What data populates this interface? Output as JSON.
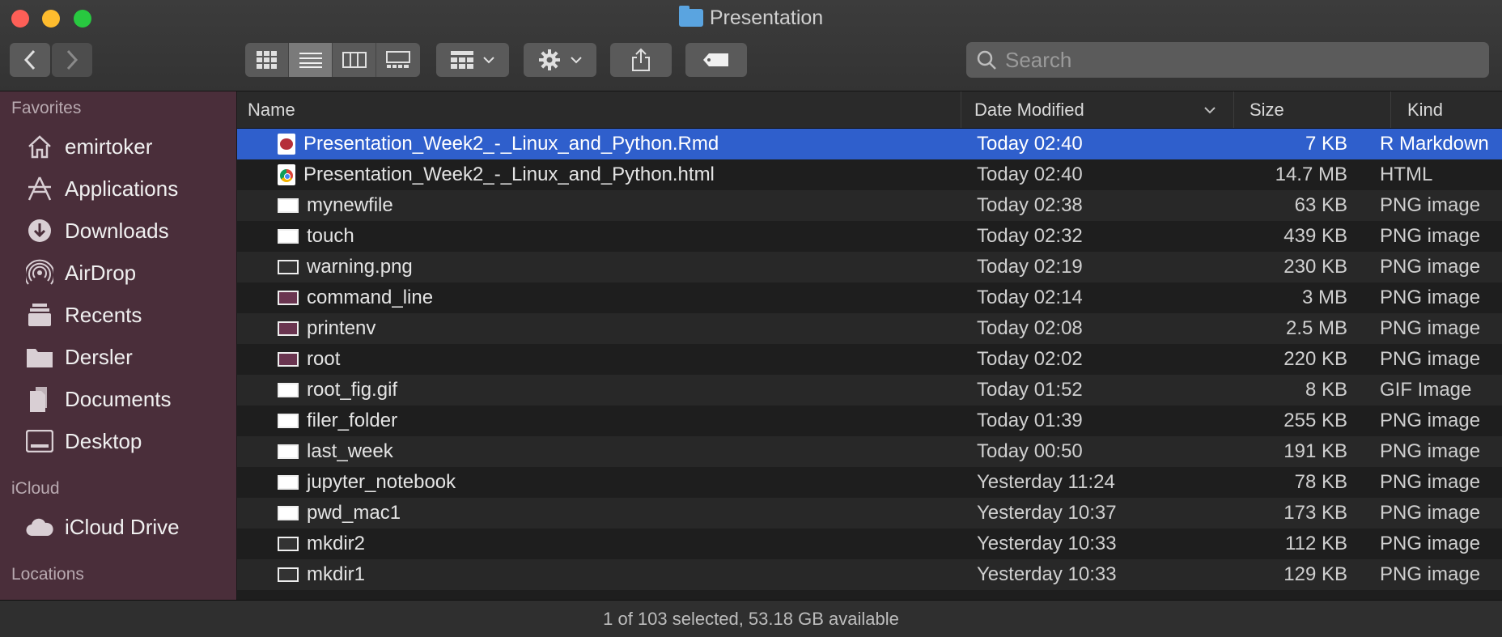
{
  "window": {
    "title": "Presentation"
  },
  "toolbar": {
    "back_icon": "chevron-left-icon",
    "forward_icon": "chevron-right-icon",
    "view_modes": [
      "icon-view-icon",
      "list-view-icon",
      "column-view-icon",
      "gallery-view-icon"
    ],
    "active_view": "list-view-icon",
    "group_icon": "group-by-icon",
    "action_icon": "gear-icon",
    "share_icon": "share-icon",
    "tag_icon": "tag-icon"
  },
  "search": {
    "placeholder": "Search"
  },
  "sidebar": {
    "favorites_header": "Favorites",
    "favorites": [
      {
        "label": "emirtoker",
        "icon": "home-icon"
      },
      {
        "label": "Applications",
        "icon": "applications-icon"
      },
      {
        "label": "Downloads",
        "icon": "downloads-icon"
      },
      {
        "label": "AirDrop",
        "icon": "airdrop-icon"
      },
      {
        "label": "Recents",
        "icon": "recents-icon"
      },
      {
        "label": "Dersler",
        "icon": "folder-icon"
      },
      {
        "label": "Documents",
        "icon": "documents-icon"
      },
      {
        "label": "Desktop",
        "icon": "desktop-icon"
      }
    ],
    "icloud_header": "iCloud",
    "icloud": [
      {
        "label": "iCloud Drive",
        "icon": "cloud-icon"
      }
    ],
    "locations_header": "Locations"
  },
  "columns": {
    "name": "Name",
    "date": "Date Modified",
    "size": "Size",
    "kind": "Kind"
  },
  "files": [
    {
      "name": "Presentation_Week2_-_Linux_and_Python.Rmd",
      "date": "Today 02:40",
      "size": "7 KB",
      "kind": "R Markdown",
      "selected": true,
      "icon": "rmd-file-icon"
    },
    {
      "name": "Presentation_Week2_-_Linux_and_Python.html",
      "date": "Today 02:40",
      "size": "14.7 MB",
      "kind": "HTML",
      "icon": "chrome-html-icon"
    },
    {
      "name": "mynewfile",
      "date": "Today 02:38",
      "size": "63 KB",
      "kind": "PNG image",
      "icon": "png-thumbnail-icon"
    },
    {
      "name": "touch",
      "date": "Today 02:32",
      "size": "439 KB",
      "kind": "PNG image",
      "icon": "png-thumbnail-icon"
    },
    {
      "name": "warning.png",
      "date": "Today 02:19",
      "size": "230 KB",
      "kind": "PNG image",
      "icon": "png-thumbnail-icon"
    },
    {
      "name": "command_line",
      "date": "Today 02:14",
      "size": "3 MB",
      "kind": "PNG image",
      "icon": "png-thumbnail-icon"
    },
    {
      "name": "printenv",
      "date": "Today 02:08",
      "size": "2.5 MB",
      "kind": "PNG image",
      "icon": "png-thumbnail-icon"
    },
    {
      "name": "root",
      "date": "Today 02:02",
      "size": "220 KB",
      "kind": "PNG image",
      "icon": "png-thumbnail-icon"
    },
    {
      "name": "root_fig.gif",
      "date": "Today 01:52",
      "size": "8 KB",
      "kind": "GIF Image",
      "icon": "gif-thumbnail-icon"
    },
    {
      "name": "filer_folder",
      "date": "Today 01:39",
      "size": "255 KB",
      "kind": "PNG image",
      "icon": "png-thumbnail-icon"
    },
    {
      "name": "last_week",
      "date": "Today 00:50",
      "size": "191 KB",
      "kind": "PNG image",
      "icon": "png-thumbnail-icon"
    },
    {
      "name": "jupyter_notebook",
      "date": "Yesterday 11:24",
      "size": "78 KB",
      "kind": "PNG image",
      "icon": "png-thumbnail-icon"
    },
    {
      "name": "pwd_mac1",
      "date": "Yesterday 10:37",
      "size": "173 KB",
      "kind": "PNG image",
      "icon": "png-thumbnail-icon"
    },
    {
      "name": "mkdir2",
      "date": "Yesterday 10:33",
      "size": "112 KB",
      "kind": "PNG image",
      "icon": "png-thumbnail-icon"
    },
    {
      "name": "mkdir1",
      "date": "Yesterday 10:33",
      "size": "129 KB",
      "kind": "PNG image",
      "icon": "png-thumbnail-icon"
    }
  ],
  "status": {
    "text": "1 of 103 selected, 53.18 GB available"
  },
  "colors": {
    "selection": "#2f5fcc",
    "sidebar": "#4a2e3a"
  }
}
